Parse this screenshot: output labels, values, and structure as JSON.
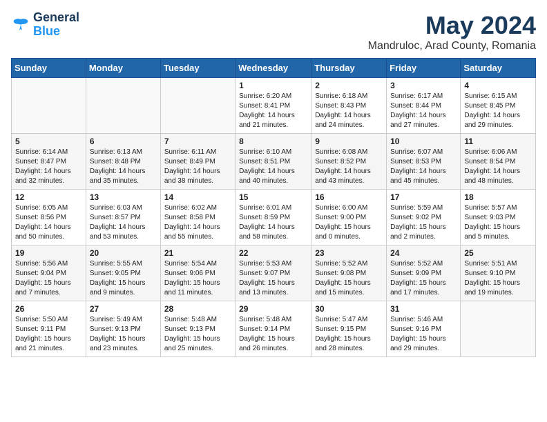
{
  "logo": {
    "line1": "General",
    "line2": "Blue"
  },
  "title": "May 2024",
  "location": "Mandruloc, Arad County, Romania",
  "weekdays": [
    "Sunday",
    "Monday",
    "Tuesday",
    "Wednesday",
    "Thursday",
    "Friday",
    "Saturday"
  ],
  "weeks": [
    [
      {
        "day": "",
        "info": ""
      },
      {
        "day": "",
        "info": ""
      },
      {
        "day": "",
        "info": ""
      },
      {
        "day": "1",
        "info": "Sunrise: 6:20 AM\nSunset: 8:41 PM\nDaylight: 14 hours\nand 21 minutes."
      },
      {
        "day": "2",
        "info": "Sunrise: 6:18 AM\nSunset: 8:43 PM\nDaylight: 14 hours\nand 24 minutes."
      },
      {
        "day": "3",
        "info": "Sunrise: 6:17 AM\nSunset: 8:44 PM\nDaylight: 14 hours\nand 27 minutes."
      },
      {
        "day": "4",
        "info": "Sunrise: 6:15 AM\nSunset: 8:45 PM\nDaylight: 14 hours\nand 29 minutes."
      }
    ],
    [
      {
        "day": "5",
        "info": "Sunrise: 6:14 AM\nSunset: 8:47 PM\nDaylight: 14 hours\nand 32 minutes."
      },
      {
        "day": "6",
        "info": "Sunrise: 6:13 AM\nSunset: 8:48 PM\nDaylight: 14 hours\nand 35 minutes."
      },
      {
        "day": "7",
        "info": "Sunrise: 6:11 AM\nSunset: 8:49 PM\nDaylight: 14 hours\nand 38 minutes."
      },
      {
        "day": "8",
        "info": "Sunrise: 6:10 AM\nSunset: 8:51 PM\nDaylight: 14 hours\nand 40 minutes."
      },
      {
        "day": "9",
        "info": "Sunrise: 6:08 AM\nSunset: 8:52 PM\nDaylight: 14 hours\nand 43 minutes."
      },
      {
        "day": "10",
        "info": "Sunrise: 6:07 AM\nSunset: 8:53 PM\nDaylight: 14 hours\nand 45 minutes."
      },
      {
        "day": "11",
        "info": "Sunrise: 6:06 AM\nSunset: 8:54 PM\nDaylight: 14 hours\nand 48 minutes."
      }
    ],
    [
      {
        "day": "12",
        "info": "Sunrise: 6:05 AM\nSunset: 8:56 PM\nDaylight: 14 hours\nand 50 minutes."
      },
      {
        "day": "13",
        "info": "Sunrise: 6:03 AM\nSunset: 8:57 PM\nDaylight: 14 hours\nand 53 minutes."
      },
      {
        "day": "14",
        "info": "Sunrise: 6:02 AM\nSunset: 8:58 PM\nDaylight: 14 hours\nand 55 minutes."
      },
      {
        "day": "15",
        "info": "Sunrise: 6:01 AM\nSunset: 8:59 PM\nDaylight: 14 hours\nand 58 minutes."
      },
      {
        "day": "16",
        "info": "Sunrise: 6:00 AM\nSunset: 9:00 PM\nDaylight: 15 hours\nand 0 minutes."
      },
      {
        "day": "17",
        "info": "Sunrise: 5:59 AM\nSunset: 9:02 PM\nDaylight: 15 hours\nand 2 minutes."
      },
      {
        "day": "18",
        "info": "Sunrise: 5:57 AM\nSunset: 9:03 PM\nDaylight: 15 hours\nand 5 minutes."
      }
    ],
    [
      {
        "day": "19",
        "info": "Sunrise: 5:56 AM\nSunset: 9:04 PM\nDaylight: 15 hours\nand 7 minutes."
      },
      {
        "day": "20",
        "info": "Sunrise: 5:55 AM\nSunset: 9:05 PM\nDaylight: 15 hours\nand 9 minutes."
      },
      {
        "day": "21",
        "info": "Sunrise: 5:54 AM\nSunset: 9:06 PM\nDaylight: 15 hours\nand 11 minutes."
      },
      {
        "day": "22",
        "info": "Sunrise: 5:53 AM\nSunset: 9:07 PM\nDaylight: 15 hours\nand 13 minutes."
      },
      {
        "day": "23",
        "info": "Sunrise: 5:52 AM\nSunset: 9:08 PM\nDaylight: 15 hours\nand 15 minutes."
      },
      {
        "day": "24",
        "info": "Sunrise: 5:52 AM\nSunset: 9:09 PM\nDaylight: 15 hours\nand 17 minutes."
      },
      {
        "day": "25",
        "info": "Sunrise: 5:51 AM\nSunset: 9:10 PM\nDaylight: 15 hours\nand 19 minutes."
      }
    ],
    [
      {
        "day": "26",
        "info": "Sunrise: 5:50 AM\nSunset: 9:11 PM\nDaylight: 15 hours\nand 21 minutes."
      },
      {
        "day": "27",
        "info": "Sunrise: 5:49 AM\nSunset: 9:13 PM\nDaylight: 15 hours\nand 23 minutes."
      },
      {
        "day": "28",
        "info": "Sunrise: 5:48 AM\nSunset: 9:13 PM\nDaylight: 15 hours\nand 25 minutes."
      },
      {
        "day": "29",
        "info": "Sunrise: 5:48 AM\nSunset: 9:14 PM\nDaylight: 15 hours\nand 26 minutes."
      },
      {
        "day": "30",
        "info": "Sunrise: 5:47 AM\nSunset: 9:15 PM\nDaylight: 15 hours\nand 28 minutes."
      },
      {
        "day": "31",
        "info": "Sunrise: 5:46 AM\nSunset: 9:16 PM\nDaylight: 15 hours\nand 29 minutes."
      },
      {
        "day": "",
        "info": ""
      }
    ]
  ]
}
